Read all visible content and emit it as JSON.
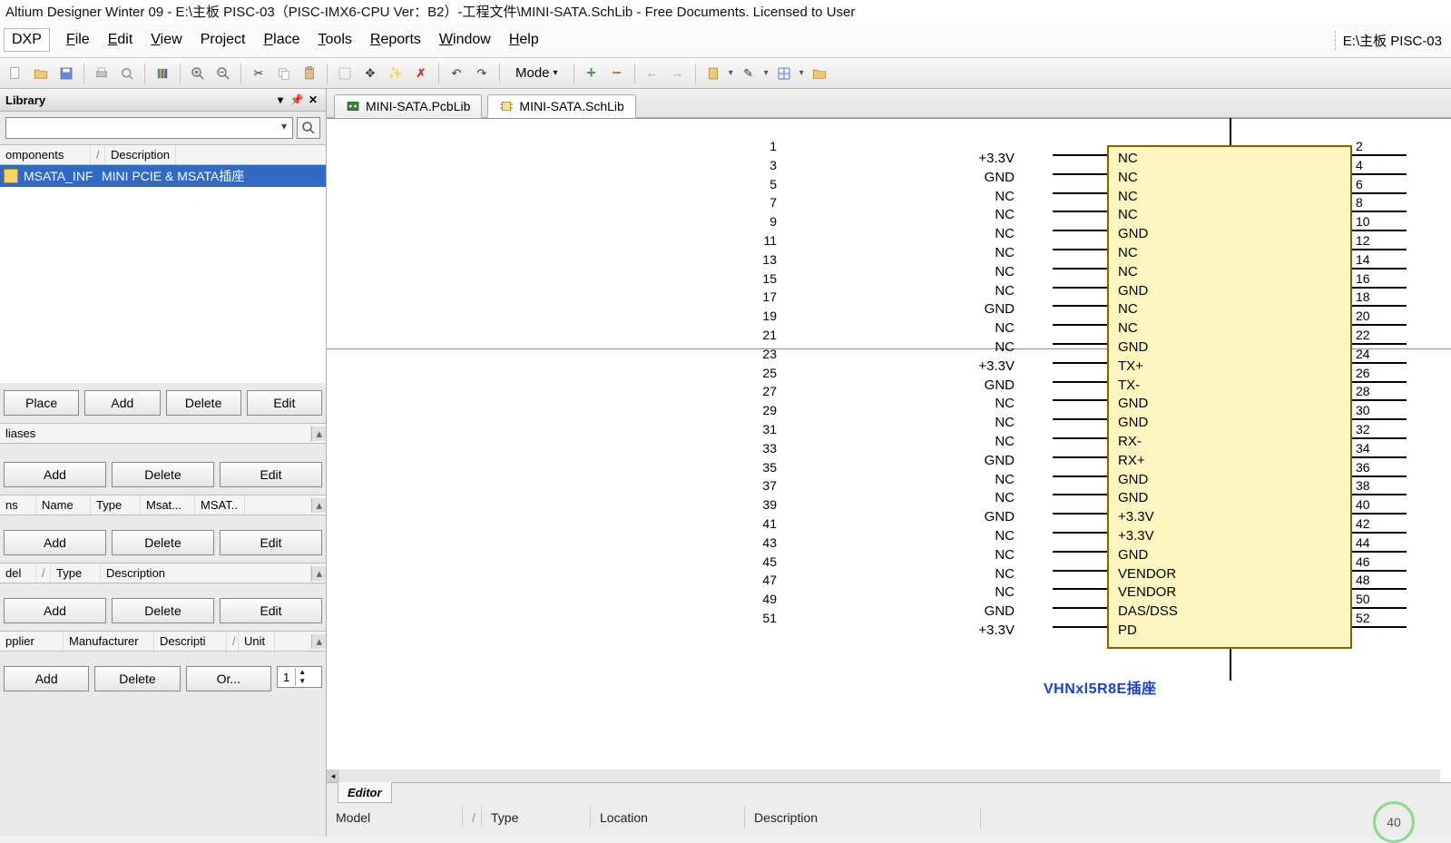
{
  "title": "Altium Designer Winter 09 - E:\\主板 PISC-03（PISC-IMX6-CPU Ver：B2）-工程文件\\MINI-SATA.SchLib - Free Documents. Licensed to User",
  "rightdoc": "E:\\主板 PISC-03",
  "menu": {
    "dxp": "DXP",
    "file": "File",
    "edit": "Edit",
    "view": "View",
    "project": "Project",
    "place": "Place",
    "tools": "Tools",
    "reports": "Reports",
    "window": "Window",
    "help": "Help"
  },
  "mode_label": "Mode",
  "panel": {
    "title": "Library",
    "header_components": "omponents",
    "header_desc": "Description",
    "item_name": "MSATA_INF",
    "item_desc": "MINI  PCIE & MSATA插座"
  },
  "btn": {
    "place": "Place",
    "add": "Add",
    "delete": "Delete",
    "edit": "Edit",
    "order": "Or..."
  },
  "sect": {
    "aliases": "liases",
    "name": "Name",
    "type": "Type",
    "msat1": "Msat...",
    "msat2": "MSAT..",
    "ins": "ns",
    "model": "del",
    "desc": "Description",
    "supplier": "pplier",
    "manuf": "Manufacturer",
    "descripti": "Descripti",
    "unit": "Unit"
  },
  "spinner_value": "1",
  "tabs": {
    "pcblib": "MINI-SATA.PcbLib",
    "schlib": "MINI-SATA.SchLib"
  },
  "caption": "VHNxl5R8E插座",
  "editor": {
    "label": "Editor",
    "model": "Model",
    "type": "Type",
    "location": "Location",
    "desc": "Description"
  },
  "gauge": "40",
  "left_pins": [
    {
      "num": "1",
      "name": "NC"
    },
    {
      "num": "3",
      "name": "NC"
    },
    {
      "num": "5",
      "name": "NC"
    },
    {
      "num": "7",
      "name": "NC"
    },
    {
      "num": "9",
      "name": "GND"
    },
    {
      "num": "11",
      "name": "NC"
    },
    {
      "num": "13",
      "name": "NC"
    },
    {
      "num": "15",
      "name": "GND"
    },
    {
      "num": "17",
      "name": "NC"
    },
    {
      "num": "19",
      "name": "NC"
    },
    {
      "num": "21",
      "name": "GND"
    },
    {
      "num": "23",
      "name": "TX+"
    },
    {
      "num": "25",
      "name": "TX-"
    },
    {
      "num": "27",
      "name": "GND"
    },
    {
      "num": "29",
      "name": "GND"
    },
    {
      "num": "31",
      "name": "RX-"
    },
    {
      "num": "33",
      "name": "RX+"
    },
    {
      "num": "35",
      "name": "GND"
    },
    {
      "num": "37",
      "name": "GND"
    },
    {
      "num": "39",
      "name": "+3.3V"
    },
    {
      "num": "41",
      "name": "+3.3V"
    },
    {
      "num": "43",
      "name": "GND"
    },
    {
      "num": "45",
      "name": "VENDOR"
    },
    {
      "num": "47",
      "name": "VENDOR"
    },
    {
      "num": "49",
      "name": "DAS/DSS"
    },
    {
      "num": "51",
      "name": "PD"
    }
  ],
  "right_pins": [
    {
      "num": "2",
      "name": "+3.3V"
    },
    {
      "num": "4",
      "name": "GND"
    },
    {
      "num": "6",
      "name": "NC"
    },
    {
      "num": "8",
      "name": "NC"
    },
    {
      "num": "10",
      "name": "NC"
    },
    {
      "num": "12",
      "name": "NC"
    },
    {
      "num": "14",
      "name": "NC"
    },
    {
      "num": "16",
      "name": "NC"
    },
    {
      "num": "18",
      "name": "GND"
    },
    {
      "num": "20",
      "name": "NC"
    },
    {
      "num": "22",
      "name": "NC"
    },
    {
      "num": "24",
      "name": "+3.3V"
    },
    {
      "num": "26",
      "name": "GND"
    },
    {
      "num": "28",
      "name": "NC"
    },
    {
      "num": "30",
      "name": "NC"
    },
    {
      "num": "32",
      "name": "NC"
    },
    {
      "num": "34",
      "name": "GND"
    },
    {
      "num": "36",
      "name": "NC"
    },
    {
      "num": "38",
      "name": "NC"
    },
    {
      "num": "40",
      "name": "GND"
    },
    {
      "num": "42",
      "name": "NC"
    },
    {
      "num": "44",
      "name": "NC"
    },
    {
      "num": "46",
      "name": "NC"
    },
    {
      "num": "48",
      "name": "NC"
    },
    {
      "num": "50",
      "name": "GND"
    },
    {
      "num": "52",
      "name": "+3.3V"
    }
  ]
}
